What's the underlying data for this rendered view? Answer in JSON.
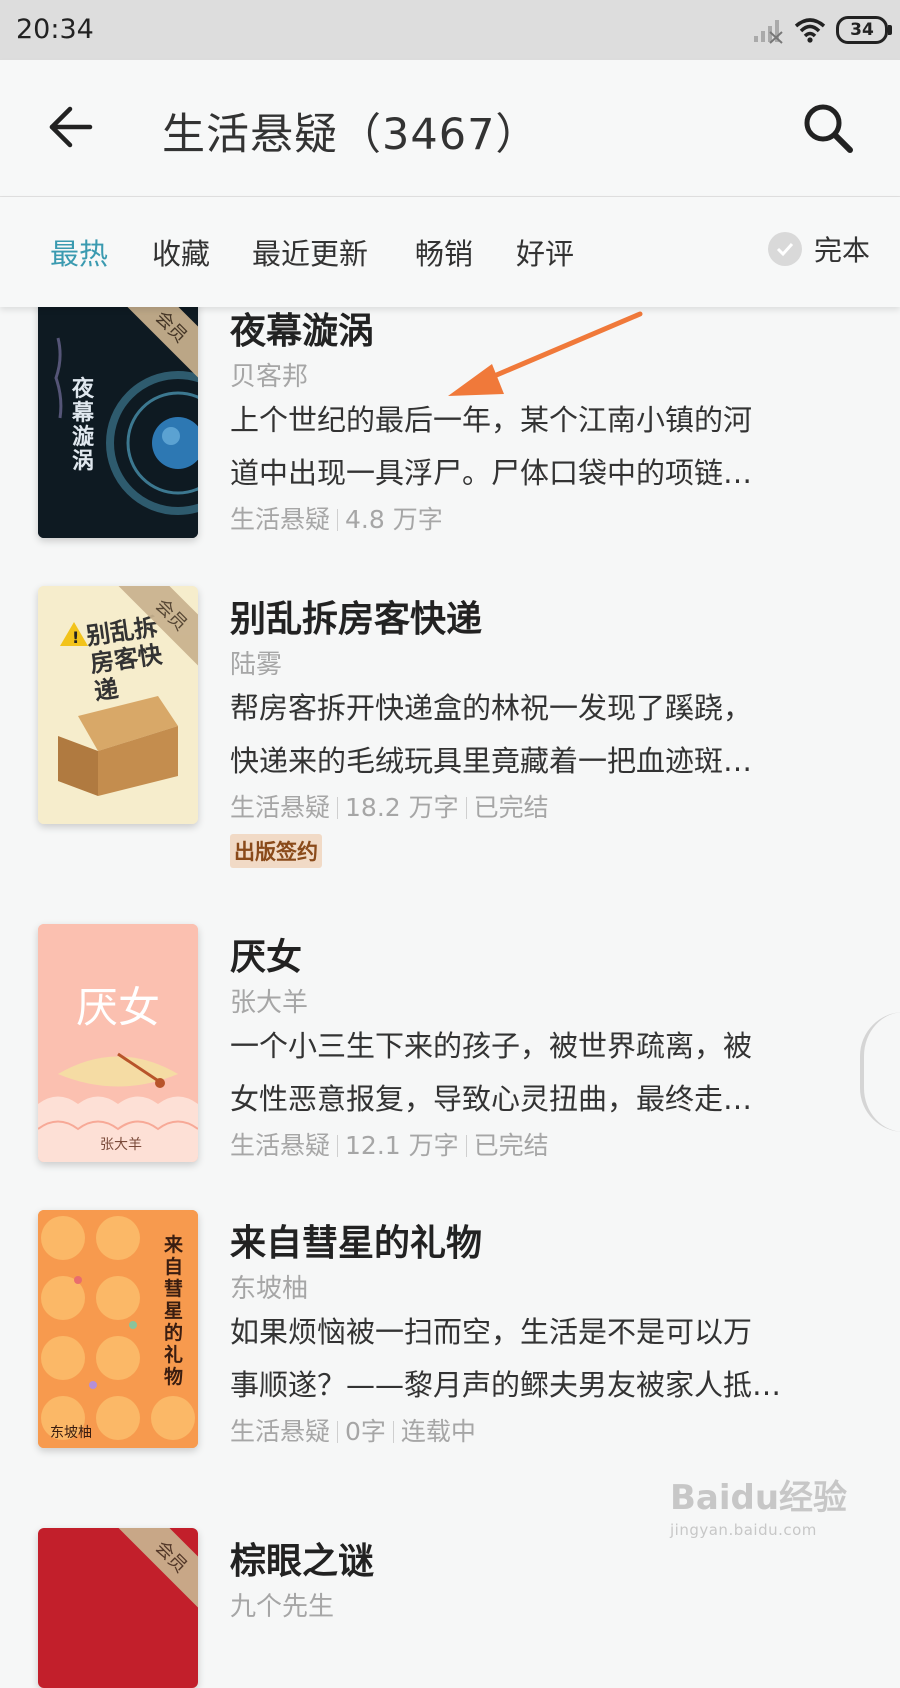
{
  "status_bar": {
    "time": "20:34",
    "battery": "34"
  },
  "header": {
    "title": "生活悬疑（3467）"
  },
  "tabs": [
    {
      "label": "最热",
      "active": true
    },
    {
      "label": "收藏",
      "active": false
    },
    {
      "label": "最近更新",
      "active": false
    },
    {
      "label": "畅销",
      "active": false
    },
    {
      "label": "好评",
      "active": false
    }
  ],
  "complete_filter": {
    "label": "完本"
  },
  "books": [
    {
      "title": "夜幕漩涡",
      "author": "贝客邦",
      "desc_line1": "上个世纪的最后一年，某个江南小镇的河",
      "desc_line2": "道中出现一具浮尸。尸体口袋中的项链…",
      "category": "生活悬疑",
      "words": "4.8 万字",
      "cover_ribbon": "会员",
      "cover_title": "夜幕漩涡"
    },
    {
      "title": "别乱拆房客快递",
      "author": "陆雾",
      "desc_line1": "帮房客拆开快递盒的林祝一发现了蹊跷，",
      "desc_line2": "快递来的毛绒玩具里竟藏着一把血迹斑…",
      "category": "生活悬疑",
      "words": "18.2 万字",
      "status": "已完结",
      "badge": "出版签约",
      "cover_ribbon": "会员",
      "cover_title": "别乱拆房客快递"
    },
    {
      "title": "厌女",
      "author": "张大羊",
      "desc_line1": "一个小三生下来的孩子，被世界疏离，被",
      "desc_line2": "女性恶意报复，导致心灵扭曲，最终走…",
      "category": "生活悬疑",
      "words": "12.1 万字",
      "status": "已完结",
      "cover_title": "厌女",
      "cover_author": "张大羊"
    },
    {
      "title": "来自彗星的礼物",
      "author": "东坡柚",
      "desc_line1": "如果烦恼被一扫而空，生活是不是可以万",
      "desc_line2": "事顺遂？——黎月声的鳏夫男友被家人抵…",
      "category": "生活悬疑",
      "words": "0字",
      "status": "连载中",
      "cover_title": "来自彗星的礼物",
      "cover_author": "东坡柚"
    },
    {
      "title": "棕眼之谜",
      "author": "九个先生",
      "cover_ribbon": "会员"
    }
  ],
  "watermark": {
    "brand": "Baidu经验",
    "url": "jingyan.baidu.com"
  },
  "colors": {
    "accent": "#3a9ab0",
    "annotation": "#f0793a"
  }
}
